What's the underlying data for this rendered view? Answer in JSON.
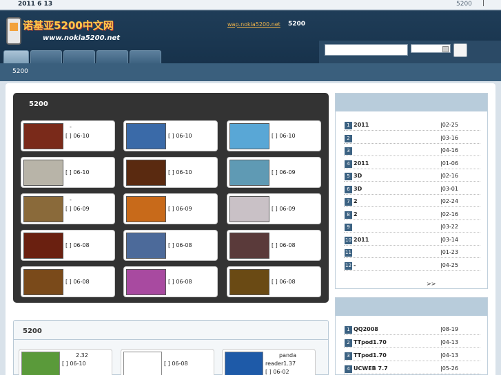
{
  "topbar": {
    "date": "2011  6  13",
    "right_link": "5200",
    "separator": "|"
  },
  "header": {
    "logo_cn": "诺基亚5200中文网",
    "logo_url": "www.nokia5200.net",
    "wap_link": "wap.nokia5200.net",
    "wap_label": "5200"
  },
  "nav": {
    "tab_count": 5
  },
  "subbar": {
    "label": "5200"
  },
  "games": {
    "title": "5200",
    "items": [
      {
        "t1": "-",
        "t2": "[ ] 06-10",
        "color": "#7a2a1a"
      },
      {
        "t1": "",
        "t2": "[ ] 06-10",
        "color": "#3a6aa8"
      },
      {
        "t1": "",
        "t2": "[ ] 06-10",
        "color": "#59a7d6"
      },
      {
        "t1": "",
        "t2": "[ ] 06-10",
        "color": "#b8b4a8"
      },
      {
        "t1": "",
        "t2": "[ ] 06-10",
        "color": "#5a2a10"
      },
      {
        "t1": "",
        "t2": "[ ] 06-09",
        "color": "#5f9ab4"
      },
      {
        "t1": "-",
        "t2": "[ ] 06-09",
        "color": "#8a6a3a"
      },
      {
        "t1": "",
        "t2": "[ ] 06-09",
        "color": "#c86a1a"
      },
      {
        "t1": "",
        "t2": "[ ] 06-09",
        "color": "#c9c1c6"
      },
      {
        "t1": "",
        "t2": "[ ] 06-08",
        "color": "#6a2010"
      },
      {
        "t1": "",
        "t2": "[ ] 06-08",
        "color": "#4c6a9a"
      },
      {
        "t1": "",
        "t2": "[ ] 06-08",
        "color": "#5a3a3a"
      },
      {
        "t1": "",
        "t2": "[ ] 06-08",
        "color": "#7a4a1a"
      },
      {
        "t1": "",
        "t2": "[ ] 06-08",
        "color": "#a84aa0"
      },
      {
        "t1": "",
        "t2": "[ ] 06-08",
        "color": "#6a4a14"
      }
    ]
  },
  "software": {
    "title": "5200",
    "items": [
      {
        "t1": "2.32",
        "t2": "[ ] 06-10",
        "t2b": "",
        "color": "#5a9a3a"
      },
      {
        "t1": "",
        "t2": "[ ] 06-08",
        "t2b": "",
        "color": "#ffffff"
      },
      {
        "t1": "panda",
        "t2": "reader1.37",
        "t2b": "[ ] 06-02",
        "color": "#1e5aa8"
      }
    ]
  },
  "rank1": {
    "rows": [
      {
        "num": "1",
        "name": "2011",
        "date": "|02-25"
      },
      {
        "num": "2",
        "name": "",
        "date": "|03-16"
      },
      {
        "num": "3",
        "name": "",
        "date": "|04-16"
      },
      {
        "num": "4",
        "name": "2011",
        "date": "|01-06"
      },
      {
        "num": "5",
        "name": "3D",
        "date": "|02-16"
      },
      {
        "num": "6",
        "name": "3D",
        "date": "|03-01"
      },
      {
        "num": "7",
        "name": "2",
        "date": "|02-24"
      },
      {
        "num": "8",
        "name": "2",
        "date": "|02-16"
      },
      {
        "num": "9",
        "name": "",
        "date": "|03-22"
      },
      {
        "num": "10",
        "name": "2011",
        "date": "|03-14"
      },
      {
        "num": "11",
        "name": "",
        "date": "|01-23"
      },
      {
        "num": "12",
        "name": "-",
        "date": "|04-25"
      }
    ],
    "more": ">>"
  },
  "rank2": {
    "rows": [
      {
        "num": "1",
        "name": "QQ2008",
        "date": "|08-19"
      },
      {
        "num": "2",
        "name": "TTpod1.70",
        "date": "|04-13"
      },
      {
        "num": "3",
        "name": "TTpod1.70",
        "date": "|04-13"
      },
      {
        "num": "4",
        "name": "UCWEB     7.7",
        "date": "|05-26"
      }
    ]
  }
}
